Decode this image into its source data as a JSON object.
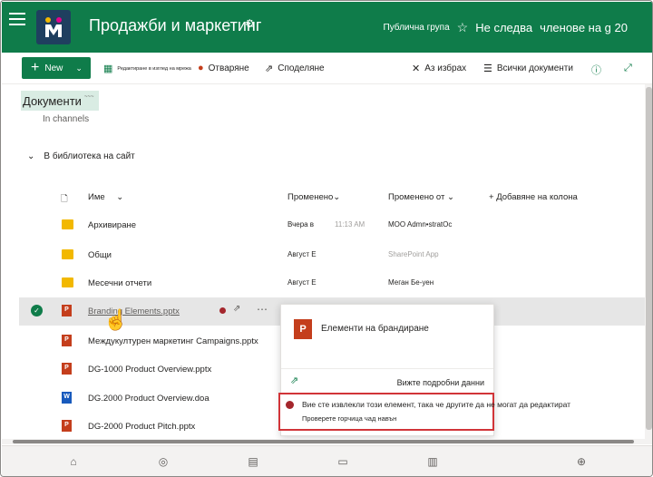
{
  "header": {
    "site_title": "Продажби и маркетинг",
    "group_type": "Публична група",
    "follow_label": "Не следва",
    "members_label": "членове на g 20"
  },
  "commandbar": {
    "new_label": "New",
    "edit_in_grid_label": "Редактиране в изглед на мрежа",
    "open_label": "Отваряне",
    "share_label": "Споделяне",
    "deselect_label": "Аз избрах",
    "all_docs_label": "Всички документи"
  },
  "library": {
    "title": "Документи",
    "title_sup": "~~~",
    "in_channels": "In channels",
    "site_library_label": "В библиотека на сайт"
  },
  "columns": {
    "name": "Име",
    "modified": "Променено",
    "modified_by": "Променено от",
    "add_column": "Добавяне на колона"
  },
  "rows": [
    {
      "type": "folder",
      "name": "Архивиране",
      "modified": "Вчера в",
      "time": "11:13 AM",
      "modified_by": "MOO Admn•stratOc",
      "muted": false
    },
    {
      "type": "folder",
      "name": "Общи",
      "modified": "Август Е",
      "time": "",
      "modified_by": "SharePoint App",
      "muted": true
    },
    {
      "type": "folder",
      "name": "Месечни отчети",
      "modified": "Август Е",
      "time": "",
      "modified_by": "Меган Бе-уен",
      "muted": false
    },
    {
      "type": "pptx",
      "name": "Branding Elements.pptx",
      "modified": "",
      "time": "",
      "modified_by": "",
      "muted": false
    },
    {
      "type": "pptx",
      "name": "Междукултурен маркетинг Campaigns.pptx",
      "modified": "",
      "time": "",
      "modified_by": "",
      "muted": false
    },
    {
      "type": "pptx",
      "name": "DG-1000 Product Overview.pptx",
      "modified": "",
      "time": "",
      "modified_by": "",
      "muted": false
    },
    {
      "type": "docx",
      "name": "DG.2000 Product Overview.doa",
      "modified": "",
      "time": "",
      "modified_by": "",
      "muted": false
    },
    {
      "type": "pptx",
      "name": "DG-2000 Product Pitch.pptx",
      "modified": "",
      "time": "",
      "modified_by": "",
      "muted": false
    }
  ],
  "card": {
    "title": "Елементи на брандиране",
    "details_label": "Вижте подробни данни",
    "alert_message": "Вие сте извлекли този елемент, така че другите да не могат да редактират",
    "alert_link": "Проверете горчица чад навън"
  },
  "colors": {
    "accent": "#0f7c4a",
    "alert_border": "#d13438",
    "pptx": "#c43e1c",
    "docx": "#185abd",
    "folder": "#f2b800"
  }
}
